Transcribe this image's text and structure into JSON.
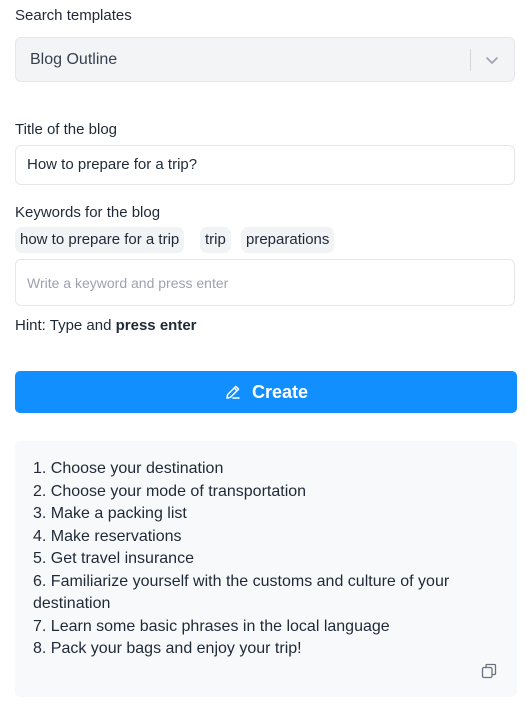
{
  "template": {
    "label": "Search templates",
    "selected": "Blog Outline"
  },
  "title_field": {
    "label": "Title of the blog",
    "value": "How to prepare for a trip?"
  },
  "keywords": {
    "label": "Keywords for the blog",
    "tags": [
      "how to prepare for a trip",
      "trip",
      "preparations"
    ],
    "input_placeholder": "Write a keyword and press enter"
  },
  "hint": {
    "prefix": "Hint: Type and",
    "emphasis": "press enter"
  },
  "create_button": {
    "label": "Create",
    "icon": "pencil-edit-icon",
    "color": "#118eff"
  },
  "result": {
    "lines": [
      "1. Choose your destination",
      "2. Choose your mode of transportation",
      "3. Make a packing list",
      "4. Make reservations",
      "5. Get travel insurance",
      "6. Familiarize yourself with the customs and culture of your destination",
      "7. Learn some basic phrases in the local language",
      "8. Pack your bags and enjoy your trip!"
    ],
    "copy_icon": "copy-icon"
  }
}
